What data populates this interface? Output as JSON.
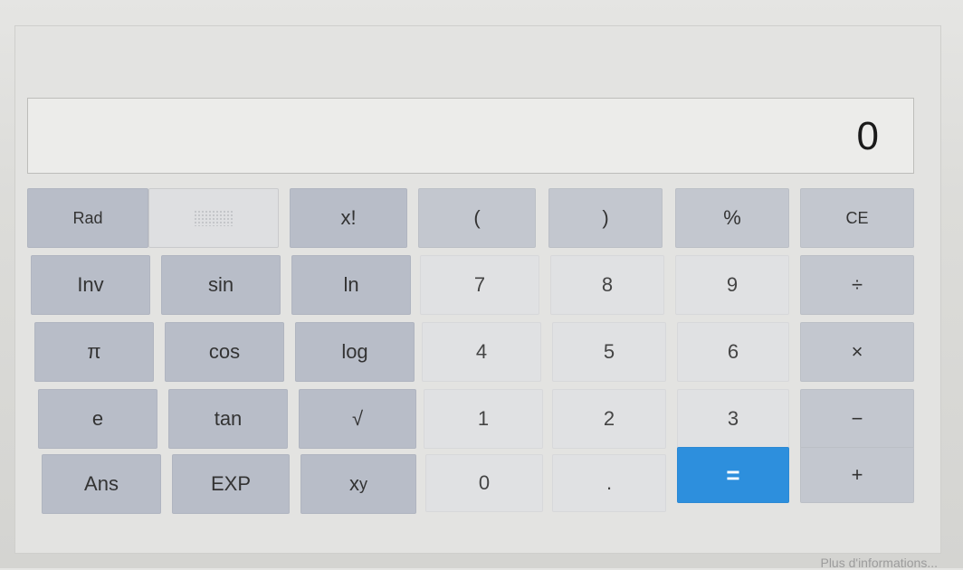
{
  "display": {
    "value": "0"
  },
  "keys": {
    "row1": {
      "rad": "Rad",
      "factorial": "x!",
      "lparen": "(",
      "rparen": ")",
      "percent": "%",
      "ce": "CE"
    },
    "row2": {
      "inv": "Inv",
      "sin": "sin",
      "ln": "ln",
      "seven": "7",
      "eight": "8",
      "nine": "9",
      "divide": "÷"
    },
    "row3": {
      "pi": "π",
      "cos": "cos",
      "log": "log",
      "four": "4",
      "five": "5",
      "six": "6",
      "multiply": "×"
    },
    "row4": {
      "e": "e",
      "tan": "tan",
      "sqrt": "√",
      "one": "1",
      "two": "2",
      "three": "3",
      "minus": "−"
    },
    "row5": {
      "ans": "Ans",
      "exp": "EXP",
      "power_base": "x",
      "power_sup": "y",
      "zero": "0",
      "dot": ".",
      "equals": "=",
      "plus": "+"
    }
  },
  "footer": {
    "more_info": "Plus d'informations..."
  },
  "colors": {
    "equals_accent": "#2d8fdd"
  }
}
